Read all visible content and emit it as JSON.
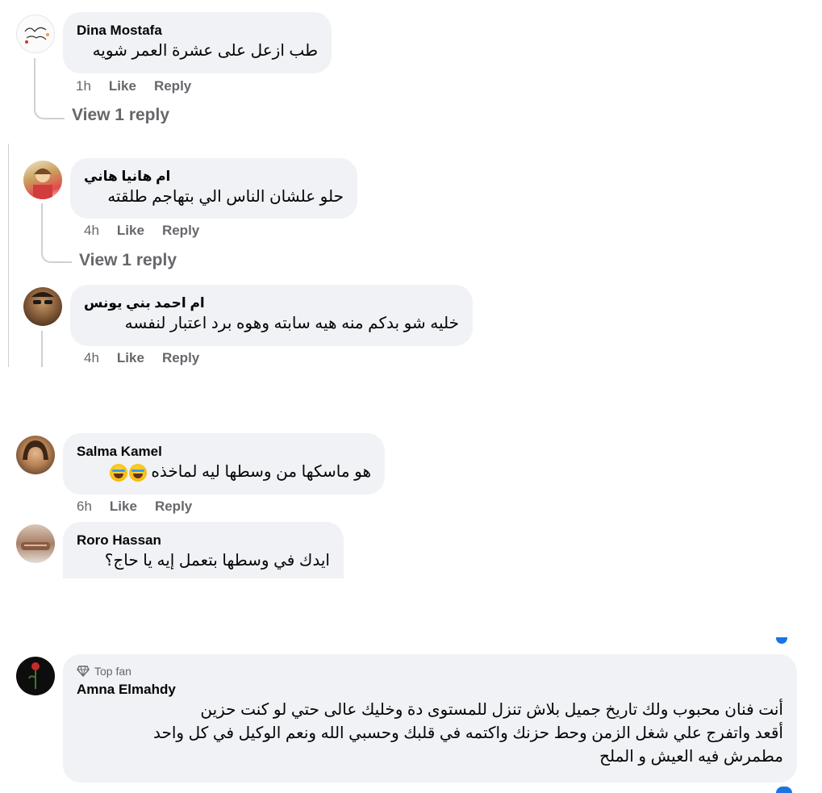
{
  "comments": [
    {
      "name": "Dina Mostafa",
      "text": "طب ازعل على عشرة العمر شويه",
      "time": "1h",
      "like": "Like",
      "reply": "Reply",
      "view_replies": "View 1 reply"
    },
    {
      "name": "ام هانيا هاني",
      "text": "حلو علشان الناس الي بتهاجم طلقته",
      "time": "4h",
      "like": "Like",
      "reply": "Reply",
      "view_replies": "View 1 reply"
    },
    {
      "name": "ام احمد بني يونس",
      "text": "خليه شو بدكم منه هيه سابته وهوه برد اعتبار لنفسه",
      "time": "4h",
      "like": "Like",
      "reply": "Reply"
    },
    {
      "name": "Salma Kamel",
      "text": "هو ماسكها من وسطها ليه لماخذه",
      "time": "6h",
      "like": "Like",
      "reply": "Reply"
    },
    {
      "name": "Roro Hassan",
      "text": "ايدك في وسطها بتعمل إيه يا حاج؟"
    },
    {
      "badge": "Top fan",
      "name": "Amna Elmahdy",
      "text_lines": [
        "أنت فنان محبوب ولك تاريخ جميل بلاش تنزل للمستوى دة وخليك عالى حتي لو كنت حزين",
        "أقعد واتفرج علي شغل الزمن وحط حزنك واكتمه في قلبك وحسبي الله ونعم الوكيل في كل واحد",
        "مطمرش فيه العيش و الملح"
      ]
    }
  ],
  "icons": {
    "top_fan": "diamond-icon",
    "laugh_emoji": "laughing-tears-emoji"
  },
  "colors": {
    "bubble": "#f0f2f5",
    "meta": "#65676b",
    "thread_line": "#ced0d4",
    "accent": "#1b74e4"
  }
}
